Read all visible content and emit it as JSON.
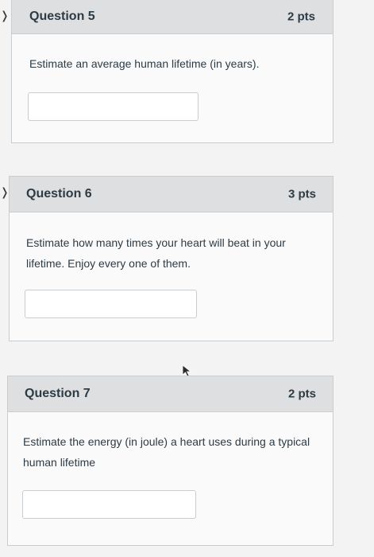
{
  "questions": [
    {
      "title": "Question 5",
      "points": "2 pts",
      "text": "Estimate an average human lifetime (in years).",
      "answer": ""
    },
    {
      "title": "Question 6",
      "points": "3 pts",
      "text": "Estimate how many times your heart will beat in your lifetime. Enjoy every one of them.",
      "answer": ""
    },
    {
      "title": "Question 7",
      "points": "2 pts",
      "text": "Estimate the energy (in joule) a heart uses during a typical human lifetime",
      "answer": ""
    }
  ],
  "icons": {
    "expand": "chevron-right-icon",
    "cursor": "mouse-pointer-icon"
  }
}
